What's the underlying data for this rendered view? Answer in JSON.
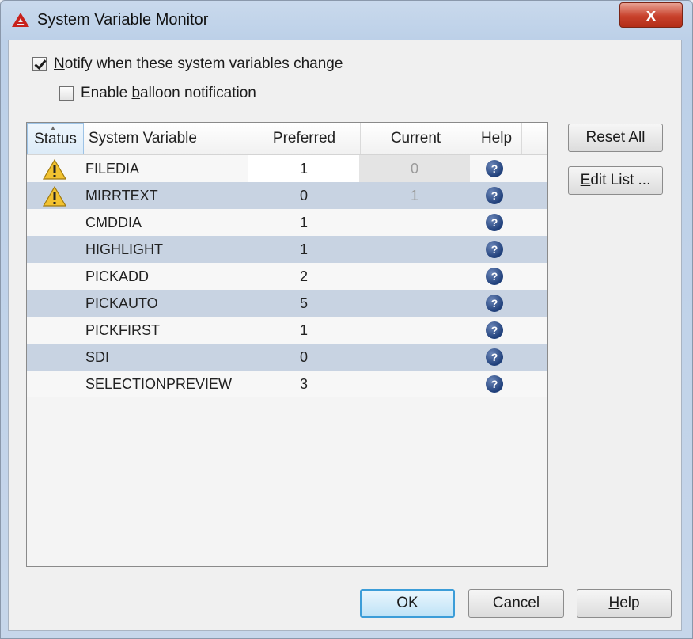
{
  "window": {
    "title": "System Variable Monitor",
    "close_glyph": "x",
    "icon": "autocad-logo-icon"
  },
  "options": {
    "notify": {
      "label_prefix": "",
      "label_key": "N",
      "label_rest": "otify when these system variables change",
      "checked": true
    },
    "balloon": {
      "label_prefix": "Enable ",
      "label_key": "b",
      "label_rest": "alloon notification",
      "checked": false
    }
  },
  "grid": {
    "columns": [
      "Status",
      "System Variable",
      "Preferred",
      "Current",
      "Help"
    ],
    "rows": [
      {
        "warning": true,
        "variable": "FILEDIA",
        "preferred": "1",
        "current": "0"
      },
      {
        "warning": true,
        "variable": "MIRRTEXT",
        "preferred": "0",
        "current": "1"
      },
      {
        "warning": false,
        "variable": "CMDDIA",
        "preferred": "1",
        "current": ""
      },
      {
        "warning": false,
        "variable": "HIGHLIGHT",
        "preferred": "1",
        "current": ""
      },
      {
        "warning": false,
        "variable": "PICKADD",
        "preferred": "2",
        "current": ""
      },
      {
        "warning": false,
        "variable": "PICKAUTO",
        "preferred": "5",
        "current": ""
      },
      {
        "warning": false,
        "variable": "PICKFIRST",
        "preferred": "1",
        "current": ""
      },
      {
        "warning": false,
        "variable": "SDI",
        "preferred": "0",
        "current": ""
      },
      {
        "warning": false,
        "variable": "SELECTIONPREVIEW",
        "preferred": "3",
        "current": ""
      }
    ],
    "help_glyph": "?"
  },
  "side_buttons": {
    "reset": {
      "key": "R",
      "rest": "eset All"
    },
    "edit": {
      "key": "E",
      "rest": "dit List ..."
    }
  },
  "footer": {
    "ok": "OK",
    "cancel": "Cancel",
    "help": {
      "key": "H",
      "rest": "elp"
    }
  },
  "colors": {
    "alt_row": "#c8d3e2",
    "warning_yellow": "#f2c230",
    "help_blue": "#1f3f7a",
    "close_red": "#c8412c"
  }
}
